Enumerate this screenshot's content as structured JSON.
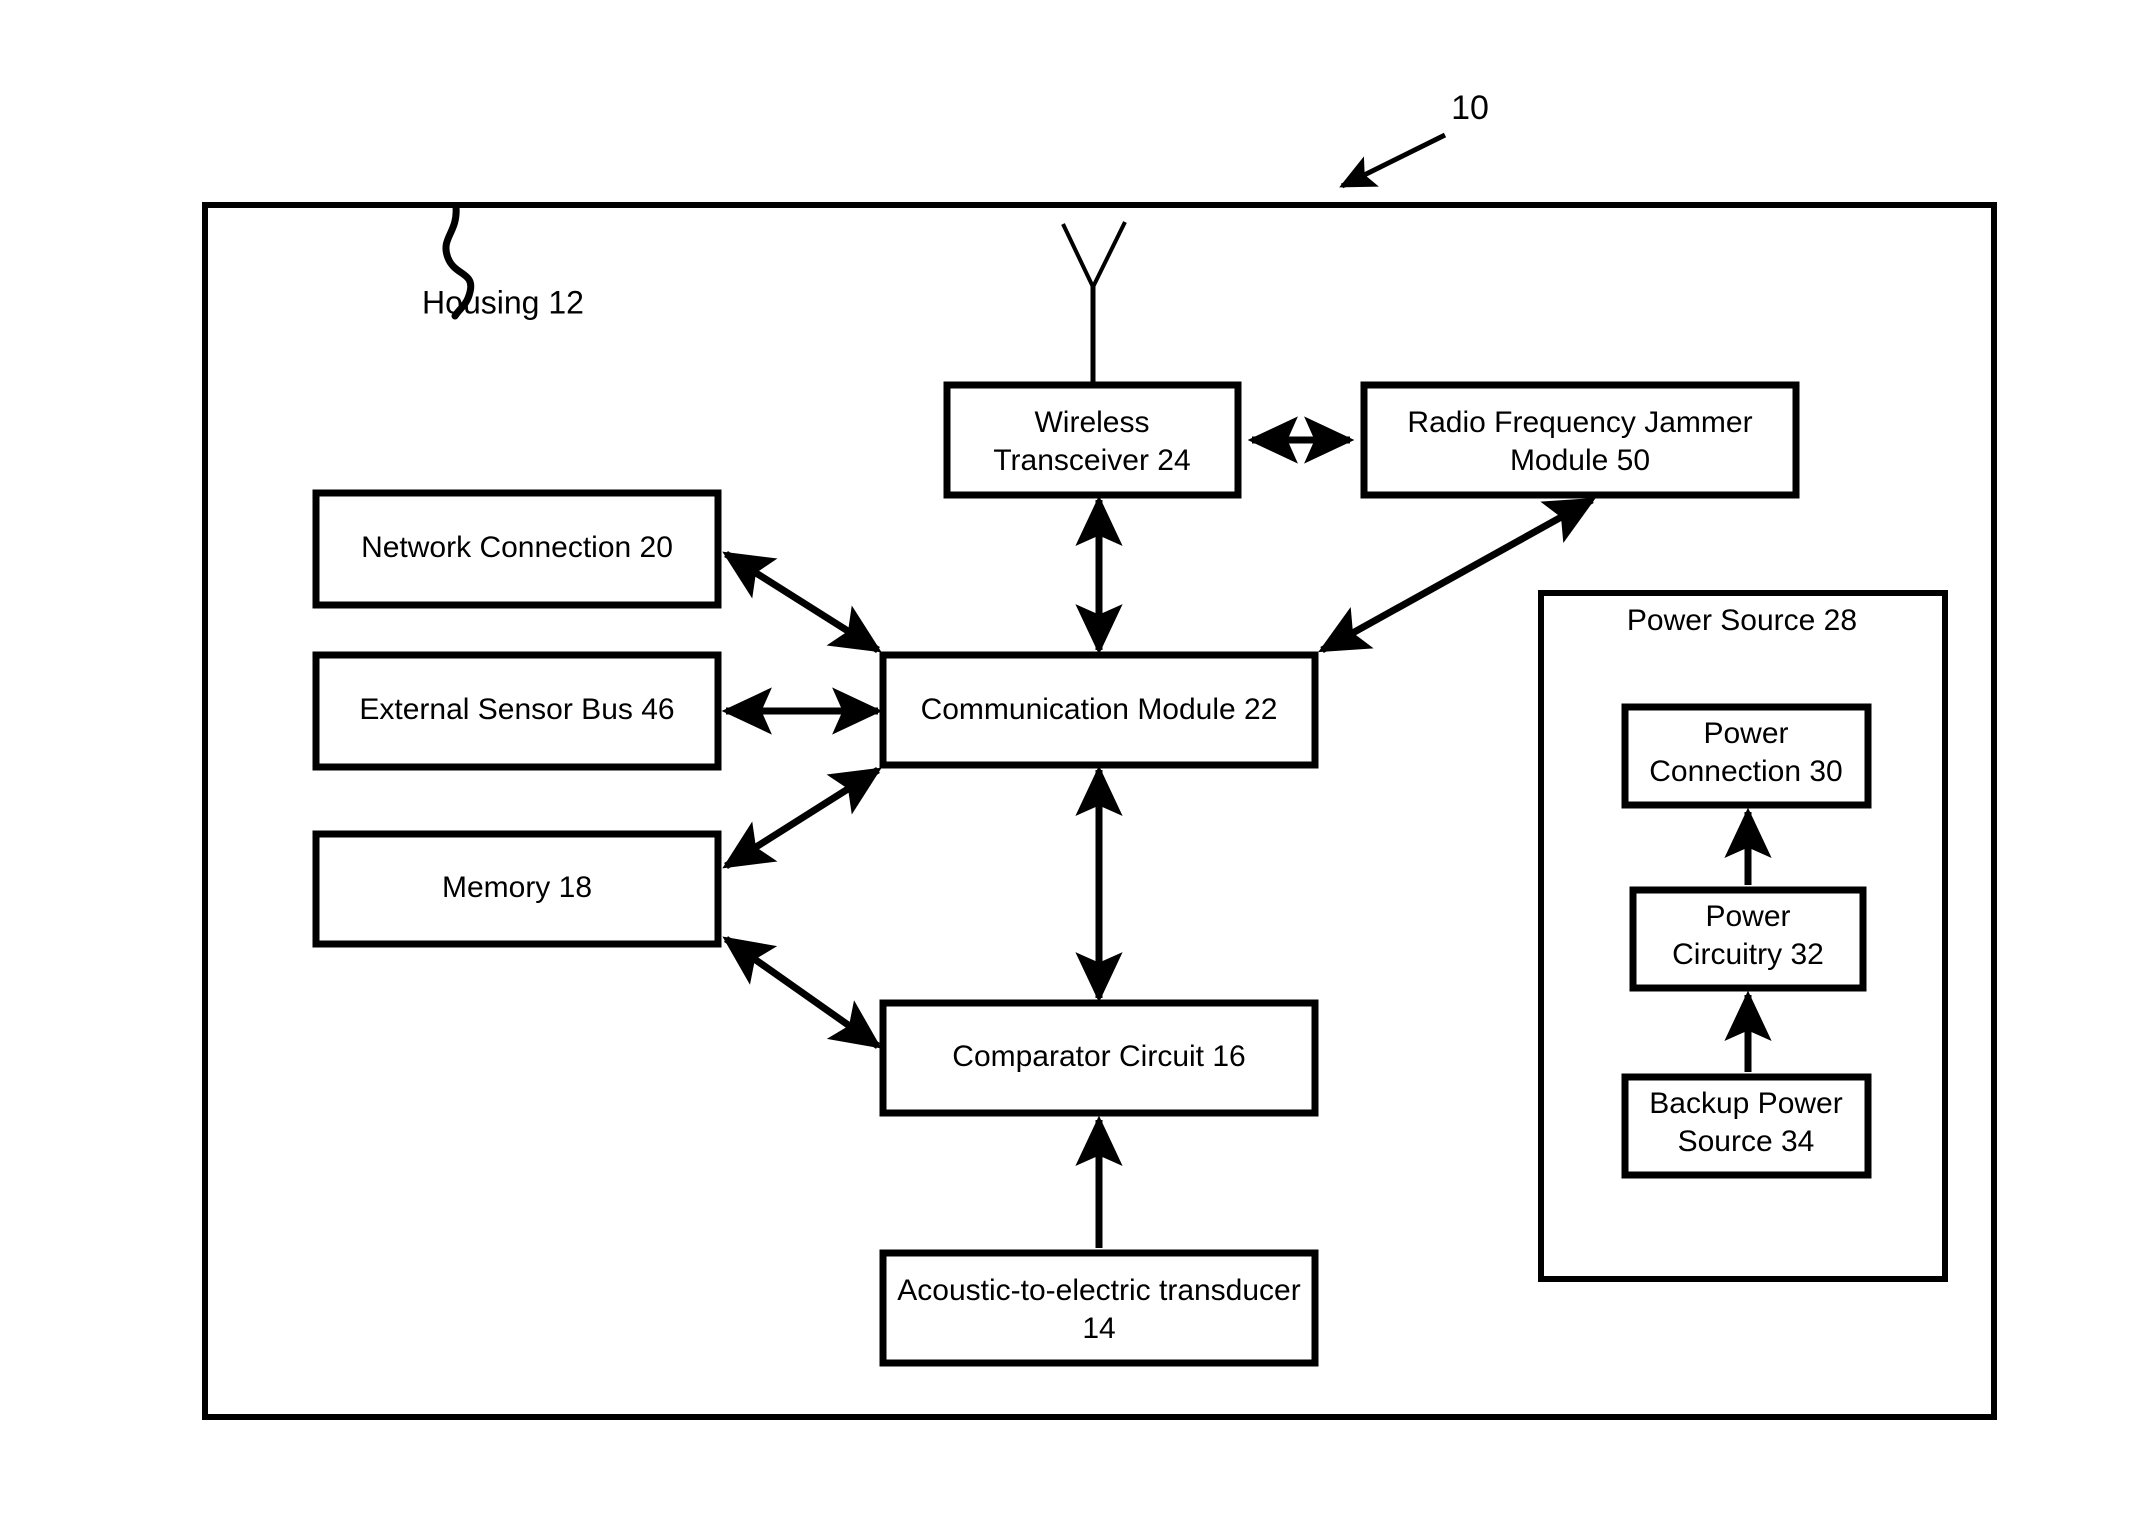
{
  "figure": {
    "reference_numeral": "10",
    "housing_label": "Housing 12"
  },
  "blocks": {
    "wireless_transceiver": {
      "line1": "Wireless",
      "line2": "Transceiver 24"
    },
    "rf_jammer": {
      "line1": "Radio Frequency Jammer",
      "line2": "Module 50"
    },
    "network_connection": {
      "line1": "Network Connection 20"
    },
    "external_sensor_bus": {
      "line1": "External Sensor Bus 46"
    },
    "memory": {
      "line1": "Memory 18"
    },
    "communication_module": {
      "line1": "Communication Module 22"
    },
    "comparator_circuit": {
      "line1": "Comparator Circuit 16"
    },
    "acoustic_transducer": {
      "line1": "Acoustic-to-electric transducer",
      "line2": "14"
    },
    "power_source": {
      "title": "Power Source 28"
    },
    "power_connection": {
      "line1": "Power",
      "line2": "Connection 30"
    },
    "power_circuitry": {
      "line1": "Power",
      "line2": "Circuitry 32"
    },
    "backup_power_source": {
      "line1": "Backup Power",
      "line2": "Source 34"
    }
  },
  "colors": {
    "stroke": "#000000",
    "fill": "#ffffff",
    "background": "#ffffff"
  },
  "connections": [
    {
      "from": "wireless_transceiver",
      "to": "rf_jammer",
      "style": "double-arrow-horizontal"
    },
    {
      "from": "wireless_transceiver",
      "to": "communication_module",
      "style": "double-arrow-vertical"
    },
    {
      "from": "communication_module",
      "to": "network_connection",
      "style": "double-arrow-diagonal"
    },
    {
      "from": "communication_module",
      "to": "external_sensor_bus",
      "style": "double-arrow-horizontal"
    },
    {
      "from": "communication_module",
      "to": "memory",
      "style": "double-arrow-diagonal"
    },
    {
      "from": "communication_module",
      "to": "rf_jammer",
      "style": "double-arrow-diagonal"
    },
    {
      "from": "communication_module",
      "to": "comparator_circuit",
      "style": "double-arrow-vertical"
    },
    {
      "from": "memory",
      "to": "comparator_circuit",
      "style": "double-arrow-diagonal"
    },
    {
      "from": "acoustic_transducer",
      "to": "comparator_circuit",
      "style": "single-arrow-up"
    },
    {
      "from": "backup_power_source",
      "to": "power_circuitry",
      "style": "single-arrow-up"
    },
    {
      "from": "power_circuitry",
      "to": "power_connection",
      "style": "single-arrow-up"
    },
    {
      "from": "wireless_transceiver",
      "to": "antenna",
      "style": "antenna-stem"
    }
  ]
}
